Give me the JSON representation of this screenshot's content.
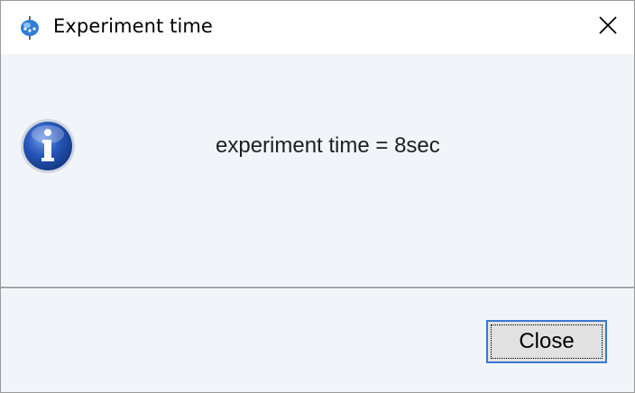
{
  "window": {
    "title": "Experiment time",
    "app_icon": "java-duke-icon",
    "close_icon": "close-icon"
  },
  "dialog": {
    "icon": "info-icon",
    "message": "experiment time = 8sec"
  },
  "footer": {
    "close_label": "Close"
  },
  "colors": {
    "accent": "#3a78d4",
    "info_blue": "#1e4fa8",
    "body_bg": "#f1f4f8"
  }
}
